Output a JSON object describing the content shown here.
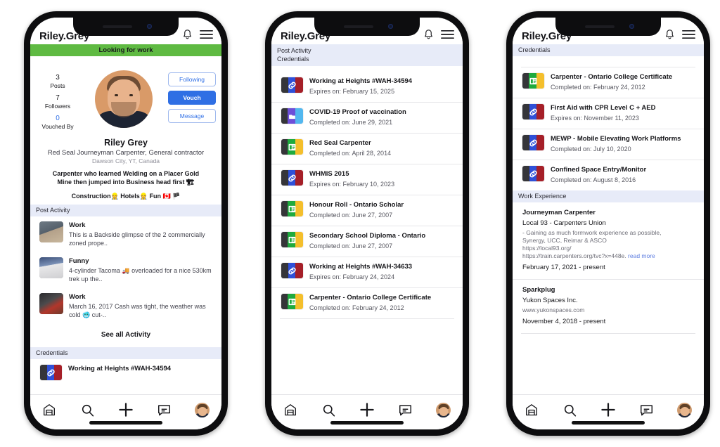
{
  "app": {
    "brand": "Riley.Grey",
    "bell_icon": "bell-icon",
    "menu_icon": "hamburger-menu-icon"
  },
  "phone1": {
    "status_banner": "Looking for work",
    "stats": [
      {
        "value": "3",
        "label": "Posts"
      },
      {
        "value": "7",
        "label": "Followers"
      },
      {
        "value": "0",
        "label": "Vouched By"
      }
    ],
    "actions": [
      {
        "label": "Following",
        "style": "outline"
      },
      {
        "label": "Vouch",
        "style": "primary"
      },
      {
        "label": "Message",
        "style": "outline"
      }
    ],
    "profile": {
      "name": "Riley Grey",
      "title": "Red Seal Journeyman Carpenter,  General contractor",
      "location": "Dawson City, YT, Canada",
      "bio_line1": "Carpenter who learned Welding on a Placer Gold",
      "bio_line2": "Mine then jumped into Business head first 🏗",
      "tags": "Construction👷 Hotels👷 Fun 🇨🇦 🏴"
    },
    "post_activity_label": "Post Activity",
    "posts": [
      {
        "title": "Work",
        "desc": "This is a Backside glimpse of the 2 commercially zoned prope..",
        "thumb": "th-a"
      },
      {
        "title": "Funny",
        "desc": "4-cylinder Tacoma 🚚 overloaded for a nice 530km trek up the..",
        "thumb": "th-b"
      },
      {
        "title": "Work",
        "desc": "March 16, 2017 Cash was tight, the weather was cold 🥶 cut-..",
        "thumb": "th-c"
      }
    ],
    "see_all_label": "See all Activity",
    "credentials_label": "Credentials",
    "credential_peek": {
      "title": "Working at Heights #WAH-34594",
      "badge": "link"
    }
  },
  "phone2": {
    "section_labels": [
      "Post Activity",
      "Credentials"
    ],
    "credentials": [
      {
        "title": "Working at Heights #WAH-34594",
        "date": "Expires on: February 15, 2025",
        "badge": "link"
      },
      {
        "title": "COVID-19 Proof of vaccination",
        "date": "Completed on: June 29, 2021",
        "badge": "covid"
      },
      {
        "title": "Red Seal Carpenter",
        "date": "Completed on: April 28, 2014",
        "badge": "cert"
      },
      {
        "title": "WHMIS 2015",
        "date": "Expires on: February 10, 2023",
        "badge": "link"
      },
      {
        "title": "Honour Roll - Ontario Scholar",
        "date": "Completed on: June 27, 2007",
        "badge": "cert"
      },
      {
        "title": "Secondary School Diploma - Ontario",
        "date": "Completed on: June 27, 2007",
        "badge": "cert"
      },
      {
        "title": "Working at Heights #WAH-34633",
        "date": "Expires on: February 24, 2024",
        "badge": "link"
      },
      {
        "title": "Carpenter - Ontario College Certificate",
        "date": "Completed on: February 24, 2012",
        "badge": "cert"
      }
    ]
  },
  "phone3": {
    "section_label": "Credentials",
    "credentials": [
      {
        "title": "Carpenter - Ontario College Certificate",
        "date": "Completed on: February 24, 2012",
        "badge": "cert"
      },
      {
        "title": "First Aid with CPR Level C + AED",
        "date": "Expires on: November 11, 2023",
        "badge": "link"
      },
      {
        "title": "MEWP - Mobile Elevating Work Platforms",
        "date": "Completed on: July 10, 2020",
        "badge": "link"
      },
      {
        "title": "Confined Space Entry/Monitor",
        "date": "Completed on: August 8, 2016",
        "badge": "link"
      }
    ],
    "work_label": "Work Experience",
    "work": [
      {
        "title": "Journeyman Carpenter",
        "company": "Local 93 - Carpenters Union",
        "desc1": "- Gaining as much formwork experience as possible,",
        "desc2": "Synergy, UCC, Reimar & ASCO",
        "desc3": "https://local93.org/",
        "desc4": "https://train.carpenters.org/tvc?x=448e.",
        "more": "read more",
        "date": "February 17, 2021 - present"
      },
      {
        "title": "Sparkplug",
        "company": "Yukon Spaces Inc.",
        "desc1": "www.yukonspaces.com",
        "date": "November 4, 2018 - present"
      }
    ]
  },
  "tabbar": {
    "items": [
      {
        "name": "home-icon",
        "label": "Home"
      },
      {
        "name": "search-icon",
        "label": "Search"
      },
      {
        "name": "plus-icon",
        "label": "Create"
      },
      {
        "name": "message-icon",
        "label": "Messages"
      },
      {
        "name": "profile-avatar",
        "label": "Profile"
      }
    ]
  },
  "colors": {
    "accent_blue": "#2f6fe4",
    "status_green": "#5fba42",
    "section_bar": "#e7ebf8",
    "badge_red": "#a51f28",
    "badge_yellow": "#f4bf2c",
    "badge_green": "#1faa3e"
  }
}
